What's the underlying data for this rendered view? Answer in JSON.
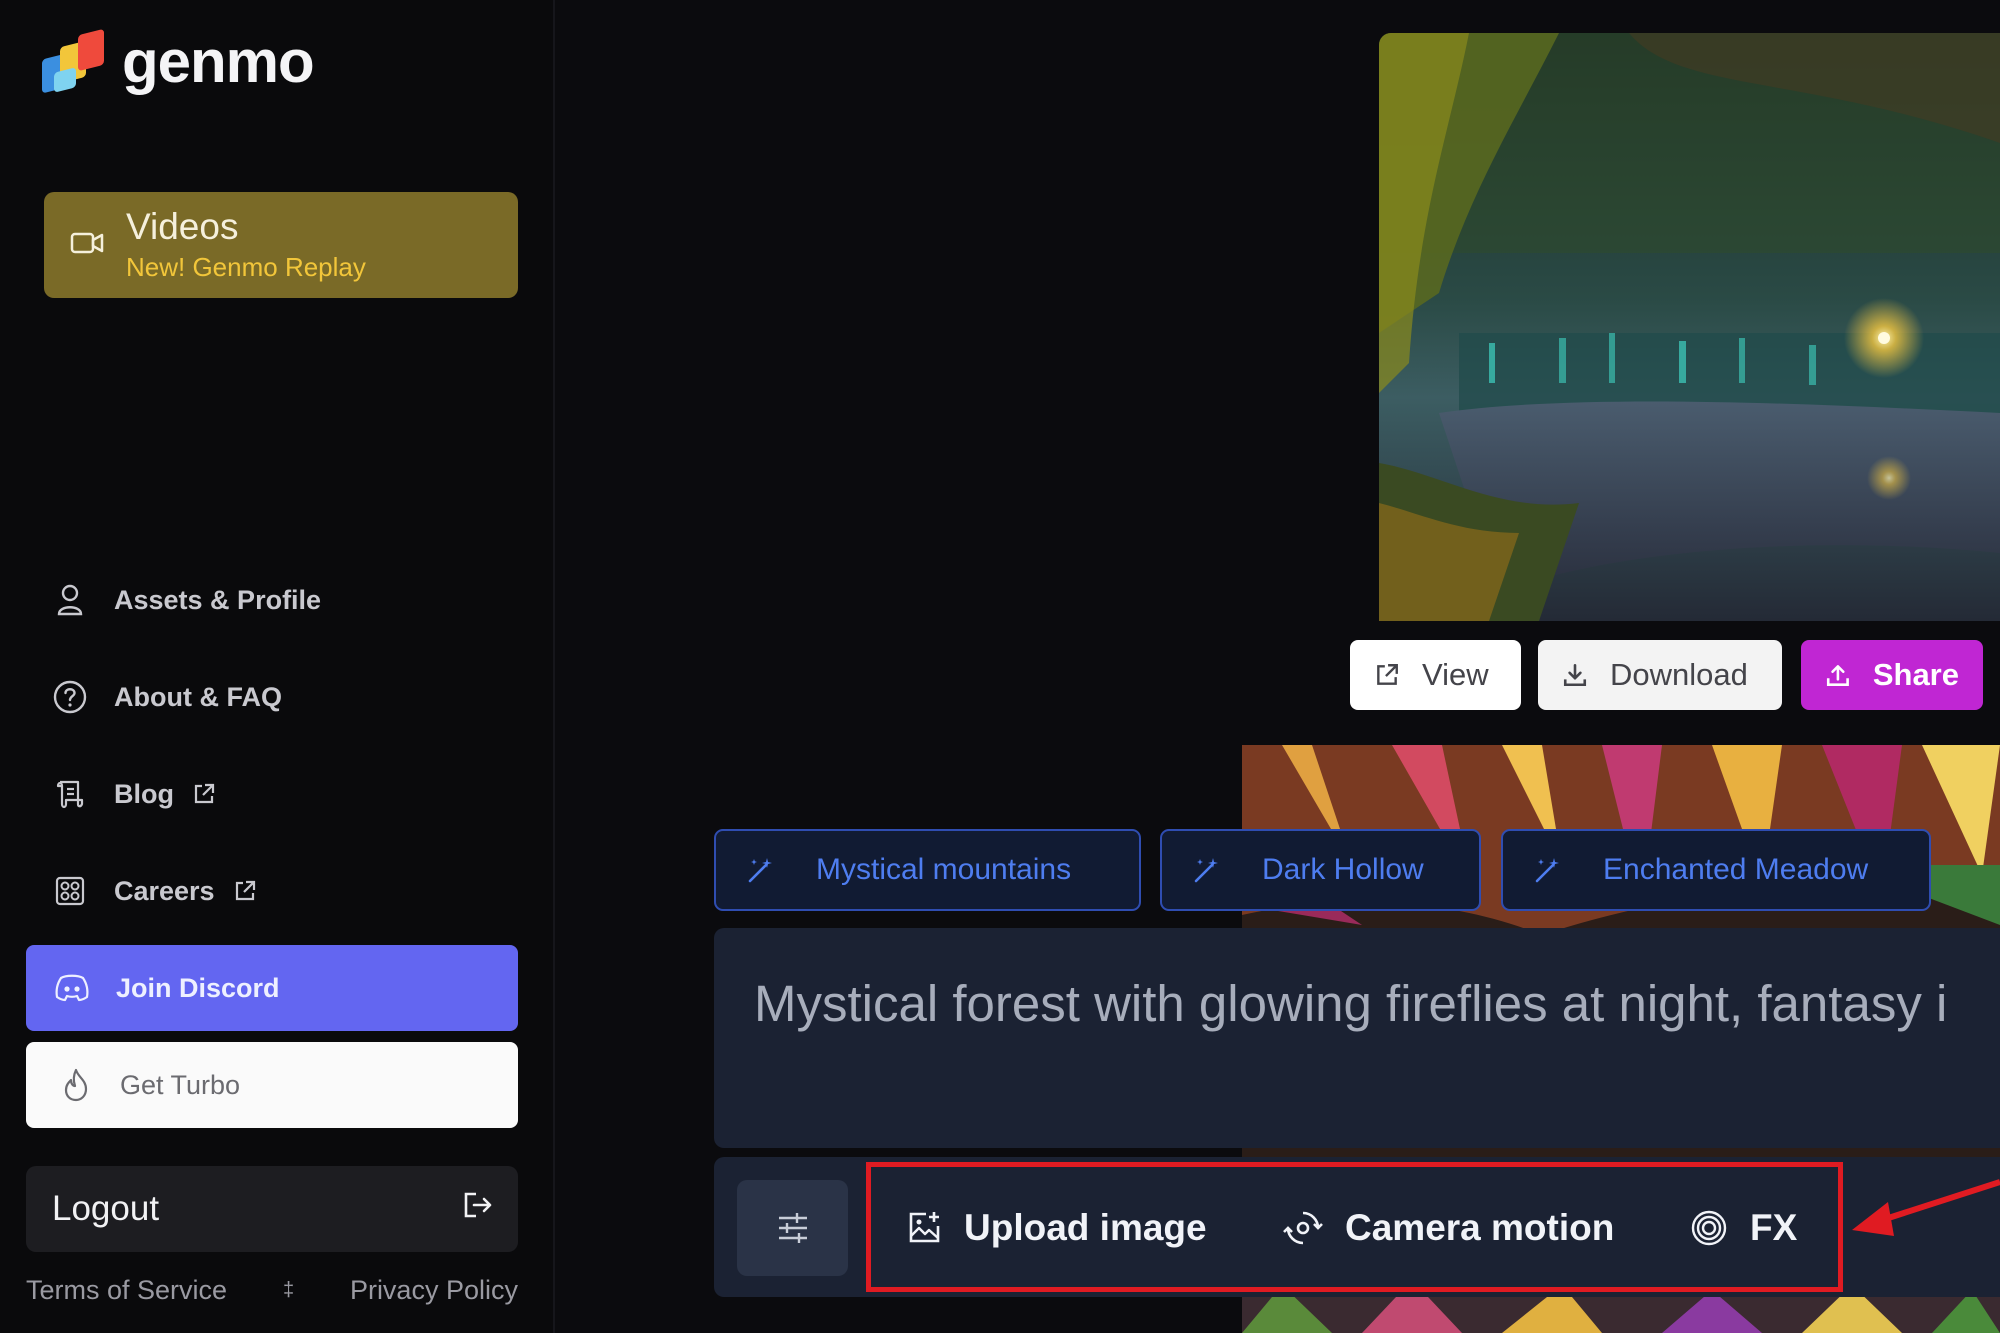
{
  "brand": {
    "name": "genmo"
  },
  "sidebar": {
    "videos": {
      "title": "Videos",
      "subtitle": "New! Genmo Replay"
    },
    "nav": [
      {
        "label": "Assets & Profile",
        "icon": "user-icon"
      },
      {
        "label": "About & FAQ",
        "icon": "question-circle-icon"
      },
      {
        "label": "Blog",
        "icon": "scroll-icon",
        "external": true
      },
      {
        "label": "Careers",
        "icon": "careers-icon",
        "external": true
      }
    ],
    "discord": {
      "label": "Join Discord",
      "icon": "discord-icon"
    },
    "turbo": {
      "label": "Get Turbo",
      "icon": "fire-icon"
    },
    "logout": {
      "label": "Logout",
      "icon": "logout-icon"
    },
    "footer": {
      "terms": "Terms of Service",
      "separator": "‡",
      "privacy": "Privacy Policy"
    }
  },
  "preview": {
    "actions": {
      "view": "View",
      "download": "Download",
      "share": "Share"
    }
  },
  "suggestions": [
    "Mystical mountains",
    "Dark Hollow",
    "Enchanted Meadow"
  ],
  "prompt": {
    "value": "Mystical forest with glowing fireflies at night, fantasy i"
  },
  "toolbar": {
    "upload": "Upload image",
    "camera": "Camera motion",
    "fx": "FX"
  },
  "colors": {
    "videos_card": "#7a6a27",
    "discord": "#6366f1",
    "share": "#c026d3",
    "chip_border": "#2f4db1",
    "chip_text": "#4e7df0",
    "highlight": "#e01b22"
  }
}
